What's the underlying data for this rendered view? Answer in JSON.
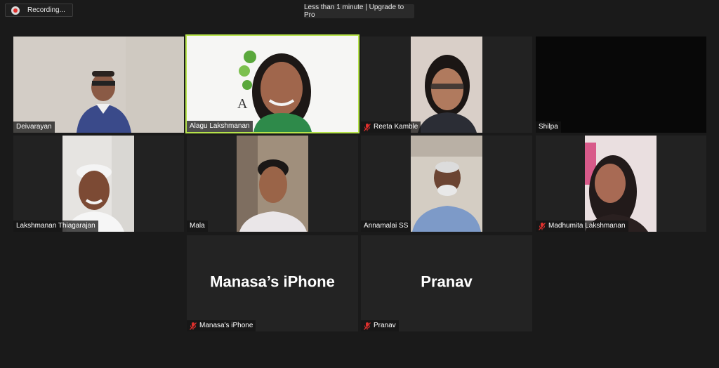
{
  "recording": {
    "label": "Recording..."
  },
  "banner": {
    "text": "Less than 1 minute | Upgrade to Pro"
  },
  "participants": [
    {
      "name": "Deivarayan",
      "muted": false
    },
    {
      "name": "Alagu Lakshmanan",
      "muted": false,
      "active_speaker": true
    },
    {
      "name": "Reeta Kamble",
      "muted": true
    },
    {
      "name": "Shilpa",
      "muted": false
    },
    {
      "name": "Lakshmanan Thiagarajan",
      "muted": false
    },
    {
      "name": "Mala",
      "muted": false
    },
    {
      "name": "Annamalai SS",
      "muted": false
    },
    {
      "name": "Madhumita Lakshmanan",
      "muted": true
    },
    {
      "name": "Manasa's iPhone",
      "muted": true,
      "display_text": "Manasa’s iPhone"
    },
    {
      "name": "Pranav",
      "muted": true,
      "display_text": "Pranav"
    }
  ],
  "colors": {
    "active_border": "#b6e34a",
    "muted_icon": "#e0302d",
    "background": "#1a1a1a"
  },
  "icons": {
    "recording": "record-dot-icon",
    "muted": "mic-off-icon"
  }
}
